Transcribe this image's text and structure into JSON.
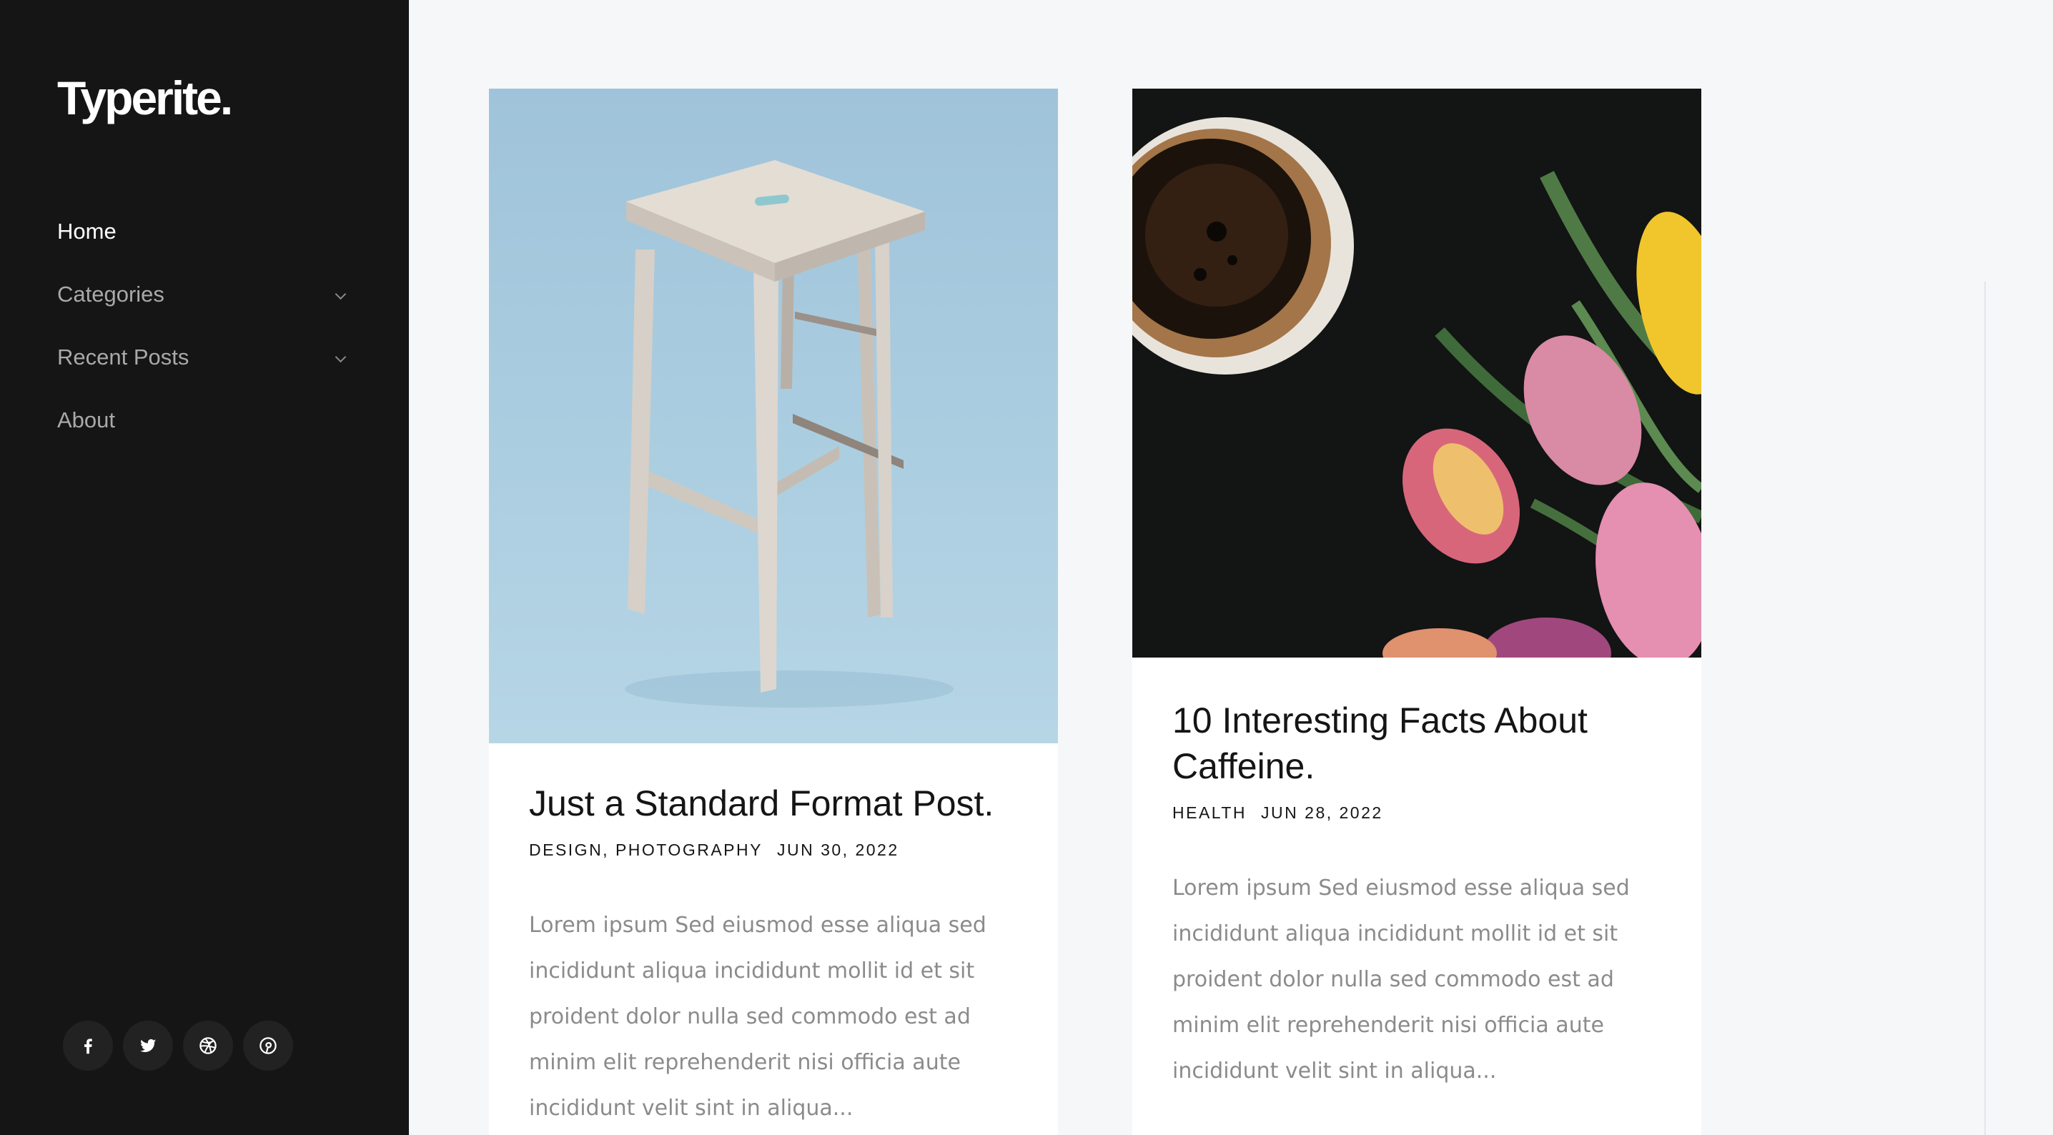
{
  "sidebar": {
    "logo": "Typerite.",
    "nav": [
      {
        "label": "Home",
        "active": true,
        "has_submenu": false
      },
      {
        "label": "Categories",
        "active": false,
        "has_submenu": true
      },
      {
        "label": "Recent Posts",
        "active": false,
        "has_submenu": true
      },
      {
        "label": "About",
        "active": false,
        "has_submenu": false
      }
    ],
    "social": [
      "facebook-icon",
      "twitter-icon",
      "dribbble-icon",
      "pinterest-icon"
    ]
  },
  "posts": [
    {
      "image": "wooden-stool-photo",
      "title": "Just a Standard Format Post.",
      "categories": "DESIGN, PHOTOGRAPHY",
      "date": "JUN 30, 2022",
      "excerpt": "Lorem ipsum Sed eiusmod esse aliqua sed incididunt aliqua incididunt mollit id et sit proident dolor nulla sed commodo est ad minim elit reprehenderit nisi officia aute incididunt velit sint in aliqua..."
    },
    {
      "image": "coffee-and-tulips-photo",
      "title": "10 Interesting Facts About Caffeine.",
      "categories": "HEALTH",
      "date": "JUN 28, 2022",
      "excerpt": "Lorem ipsum Sed eiusmod esse aliqua sed incididunt aliqua incididunt mollit id et sit proident dolor nulla sed commodo est ad minim elit reprehenderit nisi officia aute incididunt velit sint in aliqua..."
    }
  ],
  "colors": {
    "sidebar_bg": "#151515",
    "page_bg": "#f6f7f8",
    "stool_bg": "#a3c6dc",
    "coffee_bg": "#131414"
  }
}
